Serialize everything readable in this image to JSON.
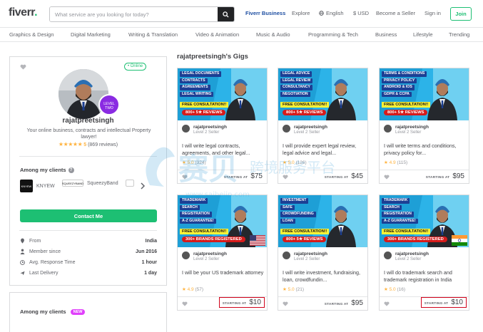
{
  "header": {
    "logo": "fiverr",
    "logo_dot": ".",
    "search_placeholder": "What service are you looking for today?",
    "business": "Fiverr Business",
    "explore": "Explore",
    "language": "English",
    "currency": "$ USD",
    "become_seller": "Become a Seller",
    "sign_in": "Sign in",
    "join": "Join"
  },
  "categories": [
    "Graphics & Design",
    "Digital Marketing",
    "Writing & Translation",
    "Video & Animation",
    "Music & Audio",
    "Programming & Tech",
    "Business",
    "Lifestyle",
    "Trending"
  ],
  "profile": {
    "online": "• Online",
    "level_line1": "LEVEL",
    "level_line2": "TWO",
    "username": "rajatpreetsingh",
    "tagline": "Your online business, contracts and intellectual Property lawyer!",
    "stars": "★★★★★",
    "rating": "5",
    "reviews": "(869 reviews)",
    "clients_title": "Among my clients",
    "clients": [
      {
        "logo": "KNYEW",
        "name": "KNYEW"
      },
      {
        "logo": "SQUEEZYBAND",
        "name": "SqueezyBand"
      }
    ],
    "contact": "Contact Me",
    "stats": [
      {
        "label": "From",
        "value": "India"
      },
      {
        "label": "Member since",
        "value": "Jun 2016"
      },
      {
        "label": "Avg. Response Time",
        "value": "1 hour"
      },
      {
        "label": "Last Delivery",
        "value": "1 day"
      }
    ],
    "clients_title_2": "Among my clients",
    "new_badge": "NEW"
  },
  "gigs_title": "rajatpreetsingh's Gigs",
  "gigs": [
    {
      "ribbons": [
        "LEGAL DOCUMENTS",
        "CONTRACTS",
        "AGREEMENTS",
        "LEGAL WRITING"
      ],
      "consult": "FREE CONSULTATION!!",
      "badge": "800+ 5★ REVIEWS",
      "seller": "rajatpreetsingh",
      "level": "Level 2 Seller",
      "title": "I will write legal contracts, agreements, and other legal...",
      "rating": "★ 5.0",
      "count": "(324)",
      "starting": "STARTING AT",
      "price": "$75",
      "highlight": false,
      "flag": ""
    },
    {
      "ribbons": [
        "LEGAL ADVICE",
        "LEGAL REVIEW",
        "CONSULTANCY",
        "NEGOTIATION"
      ],
      "consult": "FREE CONSULTATION!!",
      "badge": "800+ 5★ REVIEWS",
      "seller": "rajatpreetsingh",
      "level": "Level 2 Seller",
      "title": "I will provide expert legal review, legal advice and legal...",
      "rating": "★ 5.0",
      "count": "(126)",
      "starting": "STARTING AT",
      "price": "$45",
      "highlight": false,
      "flag": ""
    },
    {
      "ribbons": [
        "TERMS & CONDITIONS",
        "PRIVACY POLICY",
        "ANDROID & IOS",
        "GDPR & CCPA"
      ],
      "consult": "FREE CONSULTATION!!",
      "badge": "800+ 5★ REVIEWS",
      "seller": "rajatpreetsingh",
      "level": "Level 2 Seller",
      "title": "I will write terms and conditions, privacy policy for...",
      "rating": "★ 4.9",
      "count": "(115)",
      "starting": "STARTING AT",
      "price": "$95",
      "highlight": false,
      "flag": ""
    },
    {
      "ribbons": [
        "TRADEMARK",
        "SEARCH",
        "REGISTRATION",
        "A-Z GUARANTEE!"
      ],
      "consult": "FREE CONSULTATION!!",
      "badge": "300+ BRANDS REGISTERED",
      "seller": "rajatpreetsingh",
      "level": "Level 2 Seller",
      "title": "I will be your US trademark attorney",
      "rating": "★ 4.9",
      "count": "(57)",
      "starting": "STARTING AT",
      "price": "$10",
      "highlight": true,
      "flag": "us"
    },
    {
      "ribbons": [
        "INVESTMENT",
        "SAFE",
        "CROWDFUNDING",
        "LOAN"
      ],
      "consult": "FREE CONSULTATION!!",
      "badge": "800+ 5★ REVIEWS",
      "seller": "rajatpreetsingh",
      "level": "Level 2 Seller",
      "title": "I will write investment, fundraising, loan, crowdfundin...",
      "rating": "★ 5.0",
      "count": "(21)",
      "starting": "STARTING AT",
      "price": "$95",
      "highlight": false,
      "flag": ""
    },
    {
      "ribbons": [
        "TRADEMARK",
        "SEARCH",
        "REGISTRATION",
        "A-Z GUARANTEE!"
      ],
      "consult": "FREE CONSULTATION!!",
      "badge": "300+ BRANDS REGISTERED",
      "seller": "rajatpreetsingh",
      "level": "Level 2 Seller",
      "title": "I will do trademark search and trademark registration in India",
      "rating": "★ 5.0",
      "count": "(16)",
      "starting": "STARTING AT",
      "price": "$10",
      "highlight": true,
      "flag": "in"
    }
  ],
  "watermark": {
    "main": "赛贝",
    "secondary": "跨境服务平台",
    "url": "www.saibeiip.com"
  },
  "colors": {
    "brand": "#1dbf73",
    "star": "#ffb33e",
    "highlight": "#d0021b",
    "business": "#1c4da1"
  }
}
